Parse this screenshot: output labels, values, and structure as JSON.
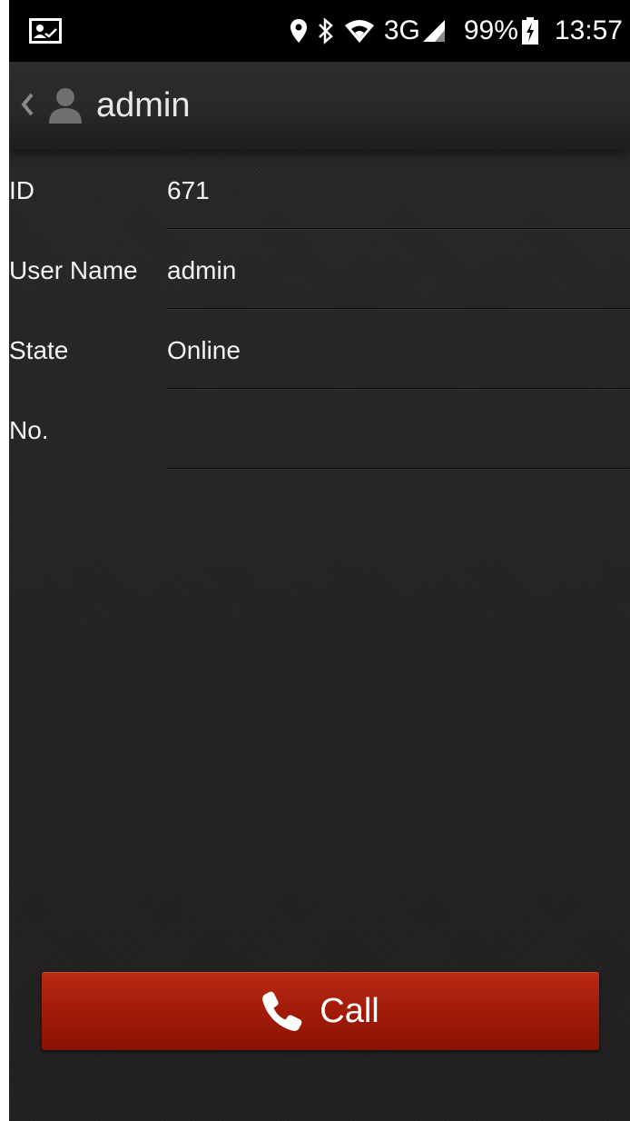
{
  "status_bar": {
    "battery": "99%",
    "network": "3G",
    "time": "13:57"
  },
  "header": {
    "title": "admin"
  },
  "details": [
    {
      "label": "ID",
      "value": "671"
    },
    {
      "label": "User Name",
      "value": "admin"
    },
    {
      "label": "State",
      "value": "Online"
    },
    {
      "label": "No.",
      "value": ""
    }
  ],
  "call_button": {
    "label": "Call"
  },
  "icons": {
    "status_left": "contact-card-icon",
    "location": "location-pin-icon",
    "bluetooth": "bluetooth-icon",
    "wifi": "wifi-icon",
    "signal": "signal-icon",
    "battery": "battery-charging-icon",
    "back": "back-chevron-icon",
    "avatar": "user-avatar-icon",
    "call": "phone-icon"
  },
  "colors": {
    "background": "#262422",
    "call_button": "#a01a08",
    "text": "#f2f2f2"
  }
}
